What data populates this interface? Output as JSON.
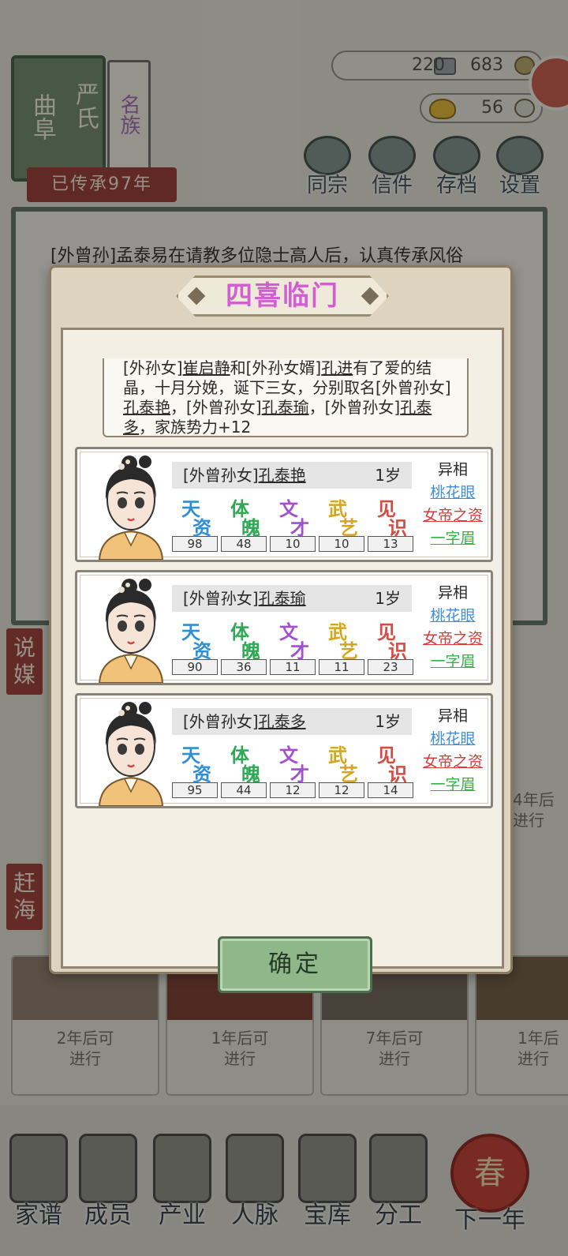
{
  "header": {
    "family_seal": {
      "book_title_left": "曲阜",
      "book_title_right": "严氏",
      "side_label": "名族"
    },
    "legacy_years": "已传承97年",
    "currency": {
      "silver": "220",
      "coins": "683",
      "gold": "56"
    },
    "top_menu": [
      {
        "label": "同宗",
        "icon": "clan-books-icon"
      },
      {
        "label": "信件",
        "icon": "letters-icon"
      },
      {
        "label": "存档",
        "icon": "archive-brush-icon"
      },
      {
        "label": "设置",
        "icon": "settings-gear-icon"
      }
    ]
  },
  "log": {
    "line": "[外曾孙]孟泰易在请教多位隐士高人后，认真传承风俗"
  },
  "side_tabs": {
    "matchmaking": "说媒",
    "sea": "赶海"
  },
  "tasks": [
    {
      "text": "2年后可\n进行"
    },
    {
      "text": "1年后可\n进行"
    },
    {
      "text": "7年后可\n进行"
    },
    {
      "text": "1年后\n进行"
    }
  ],
  "right_note": "4年后\n进行",
  "bottom_nav": [
    {
      "label": "家谱",
      "icon": "genealogy-book-icon"
    },
    {
      "label": "成员",
      "icon": "member-portrait-icon"
    },
    {
      "label": "产业",
      "icon": "industry-building-icon"
    },
    {
      "label": "人脉",
      "icon": "network-web-icon"
    },
    {
      "label": "宝库",
      "icon": "treasure-box-icon"
    },
    {
      "label": "分工",
      "icon": "scroll-assignment-icon"
    },
    {
      "label": "下一年",
      "icon": "lantern-spring-icon",
      "glyph": "春"
    }
  ],
  "modal": {
    "title": "四喜临门",
    "event": {
      "p1": "[外孙女]",
      "n1": "崔启静",
      "p2": "和[外孙女婿]",
      "n2": "孔进",
      "p3": "有了爱的结晶，十月分娩，诞下三女，分别取名[外曾孙女]",
      "n3": "孔泰艳",
      "p4": "，[外曾孙女]",
      "n4": "孔泰瑜",
      "p5": "，[外曾孙女]",
      "n5": "孔泰多",
      "p6": "，家族势力+12"
    },
    "stat_labels": [
      {
        "a": "天",
        "b": "资",
        "color": "#2f8fd6"
      },
      {
        "a": "体",
        "b": "魄",
        "color": "#2eaa55"
      },
      {
        "a": "文",
        "b": "才",
        "color": "#a24fd1"
      },
      {
        "a": "武",
        "b": "艺",
        "color": "#d6a51c"
      },
      {
        "a": "见",
        "b": "识",
        "color": "#d24d43"
      }
    ],
    "children": [
      {
        "prefix": "[外曾孙女]",
        "name": "孔泰艳",
        "age": "1岁",
        "stats": [
          "98",
          "48",
          "10",
          "10",
          "13"
        ],
        "trait_head": "异相",
        "traits": [
          {
            "text": "桃花眼",
            "color": "#3f8fd8"
          },
          {
            "text": "女帝之资",
            "color": "#d83a3a"
          },
          {
            "text": "一字眉",
            "color": "#36b348"
          }
        ]
      },
      {
        "prefix": "[外曾孙女]",
        "name": "孔泰瑜",
        "age": "1岁",
        "stats": [
          "90",
          "36",
          "11",
          "11",
          "23"
        ],
        "trait_head": "异相",
        "traits": [
          {
            "text": "桃花眼",
            "color": "#3f8fd8"
          },
          {
            "text": "女帝之资",
            "color": "#d83a3a"
          },
          {
            "text": "一字眉",
            "color": "#36b348"
          }
        ]
      },
      {
        "prefix": "[外曾孙女]",
        "name": "孔泰多",
        "age": "1岁",
        "stats": [
          "95",
          "44",
          "12",
          "12",
          "14"
        ],
        "trait_head": "异相",
        "traits": [
          {
            "text": "桃花眼",
            "color": "#3f8fd8"
          },
          {
            "text": "女帝之资",
            "color": "#d83a3a"
          },
          {
            "text": "一字眉",
            "color": "#36b348"
          }
        ]
      }
    ],
    "confirm_label": "确定"
  }
}
